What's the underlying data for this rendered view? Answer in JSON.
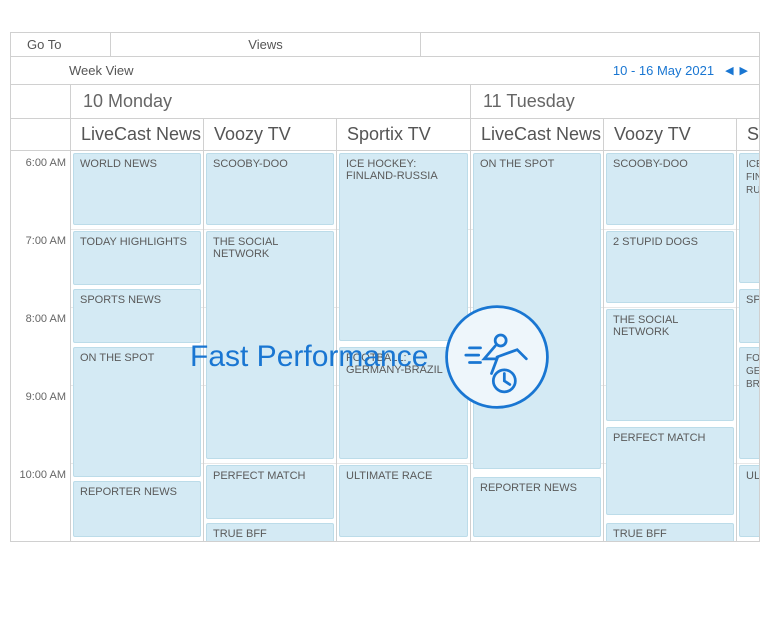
{
  "toolbar": {
    "goto": "Go To",
    "views": "Views"
  },
  "weekbar": {
    "view_label": "Week View",
    "date_range": "10  - 16 May 2021"
  },
  "days": {
    "monday": "10 Monday",
    "tuesday": "11 Tuesday"
  },
  "channels": {
    "livecast": "LiveCast News",
    "voozy": "Voozy TV",
    "sportix": "Sportix TV",
    "sp_trunc": "Sp"
  },
  "time_labels": {
    "t6": "6:00 AM",
    "t7": "7:00 AM",
    "t8": "8:00 AM",
    "t9": "9:00 AM",
    "t10": "10:00 AM"
  },
  "events": {
    "world_news": "WORLD NEWS",
    "today_highlights": "TODAY HIGHLIGHTS",
    "sports_news": "SPORTS NEWS",
    "on_the_spot": "ON THE SPOT",
    "reporter_news": "REPORTER NEWS",
    "scooby_doo": "SCOOBY-DOO",
    "social_network": "THE SOCIAL NETWORK",
    "perfect_match": "PERFECT MATCH",
    "true_bff": "TRUE BFF",
    "ice_hockey": "ICE HOCKEY: FINLAND-RUSSIA",
    "football": "FOOTBALL: GERMANY-BRAZIL",
    "ultimate_race": "ULTIMATE RACE",
    "two_stupid_dogs": "2 STUPID DOGS",
    "sp_trunc": "SP",
    "ice_trunc": "ICE FIN RU",
    "fo_trunc": "FO GE BR",
    "ul_trunc": "UL"
  },
  "overlay": {
    "text": "Fast Performance"
  }
}
